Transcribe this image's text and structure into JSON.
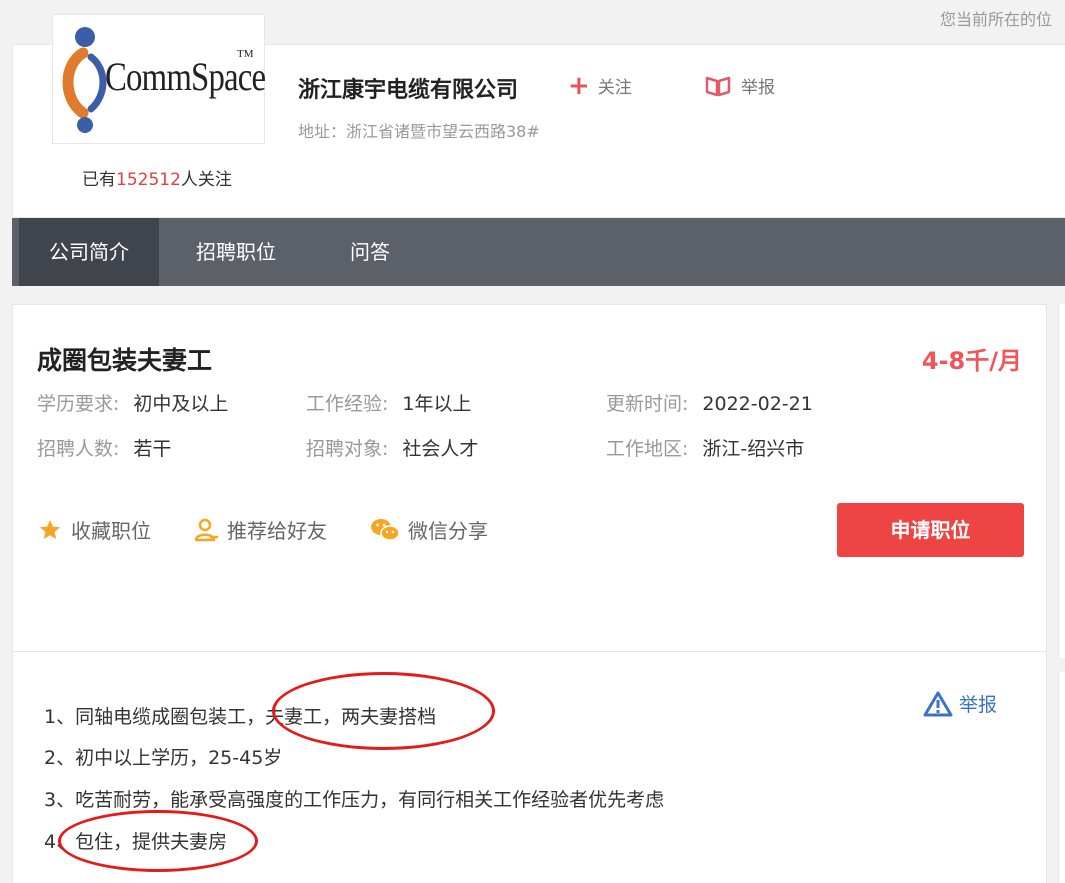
{
  "breadcrumb": "您当前所在的位",
  "company": {
    "logo_text": "CommSpace",
    "logo_tm": "TM",
    "name": "浙江康宇电缆有限公司",
    "follow_label": "关注",
    "report_label": "举报",
    "address": "地址：浙江省诸暨市望云西路38#",
    "followers_prefix": "已有",
    "followers_count": "152512",
    "followers_suffix": "人关注"
  },
  "tabs": [
    {
      "label": "公司简介",
      "active": true
    },
    {
      "label": "招聘职位",
      "active": false
    },
    {
      "label": "问答",
      "active": false
    }
  ],
  "job": {
    "title": "成圈包装夫妻工",
    "salary": "4-8千/月",
    "fields": {
      "education_k": "学历要求:",
      "education_v": "初中及以上",
      "experience_k": "工作经验:",
      "experience_v": "1年以上",
      "updated_k": "更新时间:",
      "updated_v": "2022-02-21",
      "headcount_k": "招聘人数:",
      "headcount_v": "若干",
      "target_k": "招聘对象:",
      "target_v": "社会人才",
      "region_k": "工作地区:",
      "region_v": "浙江-绍兴市"
    },
    "actions": {
      "favorite": "收藏职位",
      "recommend": "推荐给好友",
      "wechat": "微信分享"
    },
    "apply_label": "申请职位"
  },
  "description": {
    "report_label": "举报",
    "lines": [
      "1、同轴电缆成圈包装工，夫妻工，两夫妻搭档",
      "2、初中以上学历，25-45岁",
      "3、吃苦耐劳，能承受高强度的工作压力，有同行相关工作经验者优先考虑",
      "4、包住，提供夫妻房"
    ]
  },
  "colors": {
    "accent_red": "#ef4444",
    "salary_red": "#f0555a",
    "tab_bar": "#5c6068",
    "tab_active": "#40444c",
    "action_orange": "#f5a623",
    "link_blue": "#3b73c4",
    "annotation_red": "#e41b1b"
  }
}
